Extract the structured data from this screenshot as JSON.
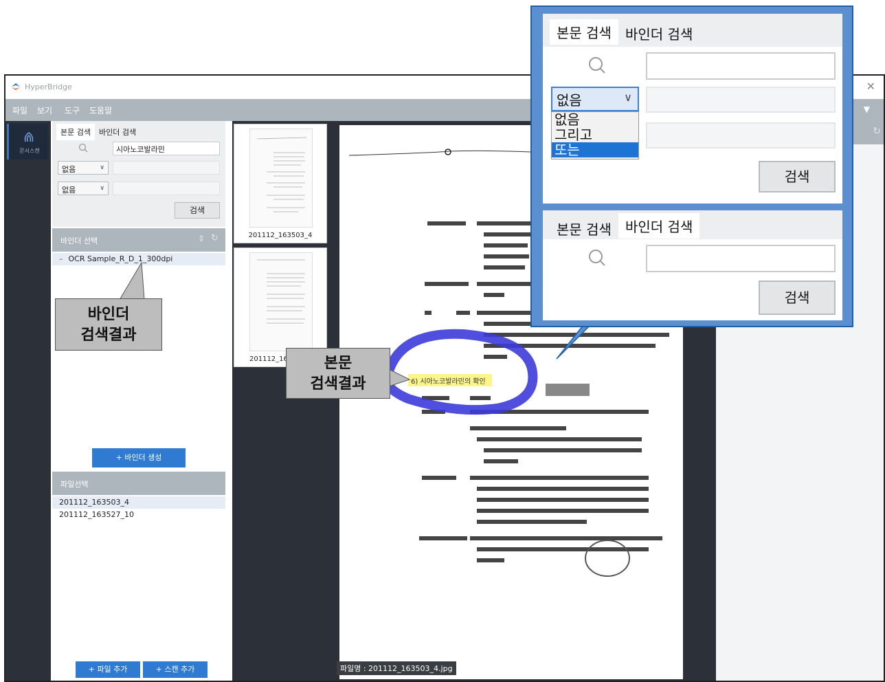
{
  "app": {
    "title": "HyperBridge",
    "close": "✕"
  },
  "menu": {
    "items": [
      "파일",
      "보기",
      "도구",
      "도움말"
    ]
  },
  "nav": {
    "label": "문서스캔"
  },
  "search": {
    "tabs": [
      "본문 검색",
      "바인더 검색"
    ],
    "query": "시아노코발라민",
    "selects": [
      "없음",
      "없음"
    ],
    "search_button": "검색"
  },
  "binder": {
    "header": "바인더 선택",
    "items": [
      "OCR Sample_R_D_1_300dpi"
    ],
    "create_button": "+ 바인더 생성"
  },
  "files": {
    "header": "파일선택",
    "items": [
      "201112_163503_4",
      "201112_163527_10"
    ],
    "add_file_button": "+ 파일 추가",
    "add_scan_button": "+ 스캔 추가"
  },
  "thumbnails": [
    "201112_163503_4",
    "201112_163"
  ],
  "viewer": {
    "filename": "파일명 : 201112_163503_4.jpg",
    "highlight_text": "6) 시아노코발라민의 확인"
  },
  "callouts": {
    "binder": [
      "바인더",
      "검색결과"
    ],
    "body": [
      "본문",
      "검색결과"
    ]
  },
  "popup": {
    "top": {
      "tabs": [
        "본문 검색",
        "바인더 검색"
      ],
      "select_value": "없음",
      "options": [
        "없음",
        "그리고",
        "또는"
      ],
      "search_button": "검색"
    },
    "bottom": {
      "tabs": [
        "본문 검색",
        "바인더 검색"
      ],
      "search_button": "검색"
    }
  },
  "colors": {
    "accent": "#2e7bd1",
    "highlight": "#fbf58a",
    "circle": "#3d3bd8"
  }
}
